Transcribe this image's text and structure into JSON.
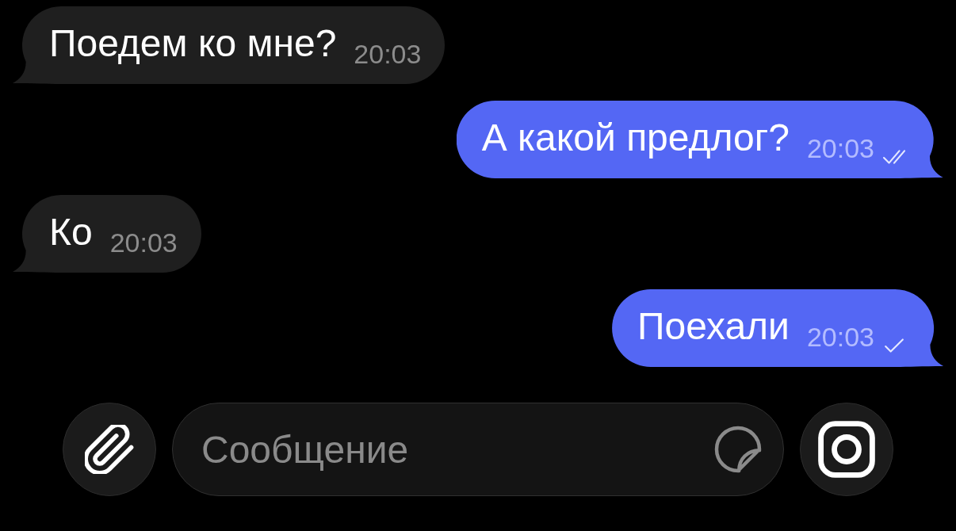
{
  "messages": [
    {
      "kind": "incoming",
      "text": "Поедем ко мне?",
      "time": "20:03"
    },
    {
      "kind": "outgoing",
      "text": "А какой предлог?",
      "time": "20:03",
      "read": true
    },
    {
      "kind": "incoming",
      "text": "Ко",
      "time": "20:03"
    },
    {
      "kind": "outgoing",
      "text": "Поехали",
      "time": "20:03",
      "read": false
    }
  ],
  "composer": {
    "placeholder": "Сообщение"
  }
}
